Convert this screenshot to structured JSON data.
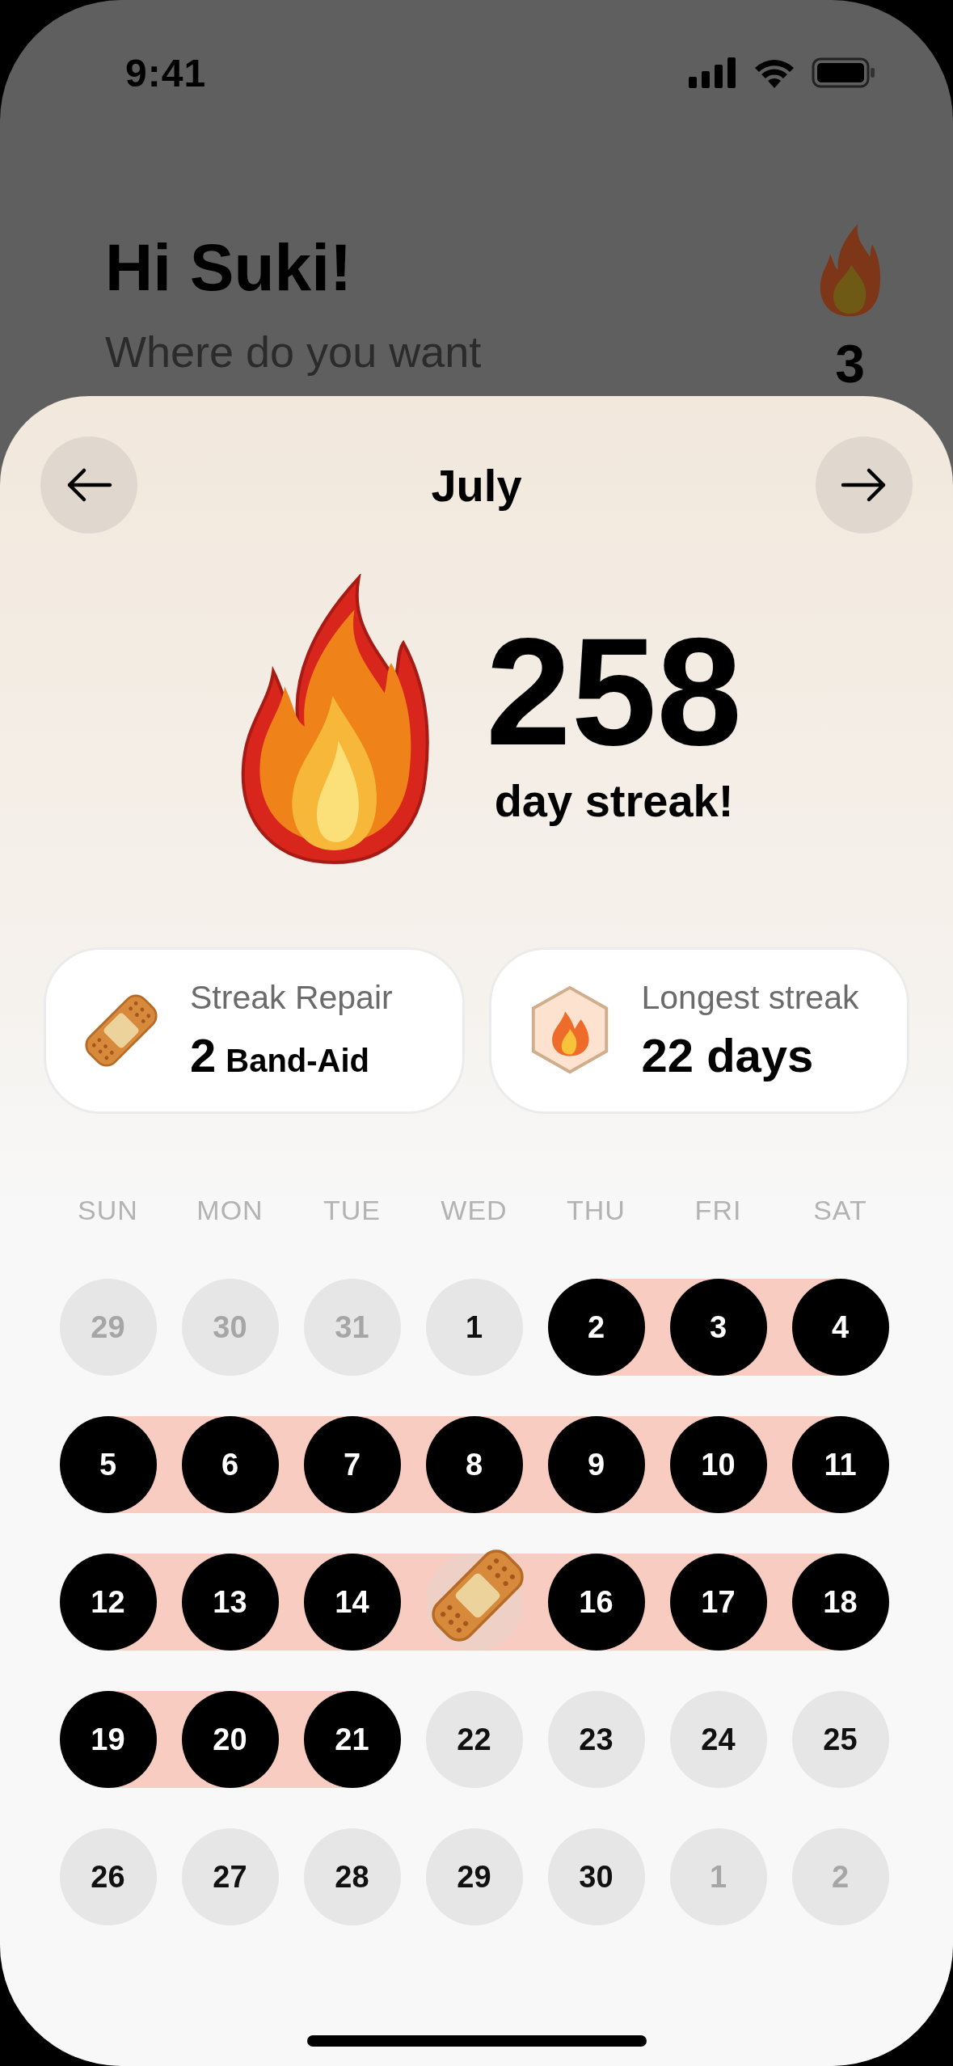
{
  "status_bar": {
    "time": "9:41"
  },
  "greeting": {
    "title": "Hi Suki!",
    "subtitle": "Where do you want",
    "streak_count": "3"
  },
  "month_nav": {
    "month": "July"
  },
  "streak": {
    "count": "258",
    "caption": "day streak!"
  },
  "cards": [
    {
      "kind": "repair",
      "label": "Streak Repair",
      "value": "2",
      "unit": "Band-Aid"
    },
    {
      "kind": "longest",
      "label": "Longest streak",
      "value": "22 days"
    }
  ],
  "calendar": {
    "weekdays": [
      "SUN",
      "MON",
      "TUE",
      "WED",
      "THU",
      "FRI",
      "SAT"
    ],
    "weeks": [
      [
        {
          "label": "29",
          "kind": "outside"
        },
        {
          "label": "30",
          "kind": "outside"
        },
        {
          "label": "31",
          "kind": "outside"
        },
        {
          "label": "1",
          "kind": "missed"
        },
        {
          "label": "2",
          "kind": "done"
        },
        {
          "label": "3",
          "kind": "done"
        },
        {
          "label": "4",
          "kind": "done"
        }
      ],
      [
        {
          "label": "5",
          "kind": "done"
        },
        {
          "label": "6",
          "kind": "done"
        },
        {
          "label": "7",
          "kind": "done"
        },
        {
          "label": "8",
          "kind": "done"
        },
        {
          "label": "9",
          "kind": "done"
        },
        {
          "label": "10",
          "kind": "done"
        },
        {
          "label": "11",
          "kind": "done"
        }
      ],
      [
        {
          "label": "12",
          "kind": "done"
        },
        {
          "label": "13",
          "kind": "done"
        },
        {
          "label": "14",
          "kind": "done"
        },
        {
          "kind": "repaired"
        },
        {
          "label": "16",
          "kind": "done"
        },
        {
          "label": "17",
          "kind": "done"
        },
        {
          "label": "18",
          "kind": "done"
        }
      ],
      [
        {
          "label": "19",
          "kind": "done"
        },
        {
          "label": "20",
          "kind": "done"
        },
        {
          "label": "21",
          "kind": "done"
        },
        {
          "label": "22",
          "kind": "missed"
        },
        {
          "label": "23",
          "kind": "missed"
        },
        {
          "label": "24",
          "kind": "missed"
        },
        {
          "label": "25",
          "kind": "missed"
        }
      ],
      [
        {
          "label": "26",
          "kind": "missed"
        },
        {
          "label": "27",
          "kind": "missed"
        },
        {
          "label": "28",
          "kind": "missed"
        },
        {
          "label": "29",
          "kind": "missed"
        },
        {
          "label": "30",
          "kind": "missed"
        },
        {
          "label": "1",
          "kind": "outside"
        },
        {
          "label": "2",
          "kind": "outside"
        }
      ]
    ]
  }
}
